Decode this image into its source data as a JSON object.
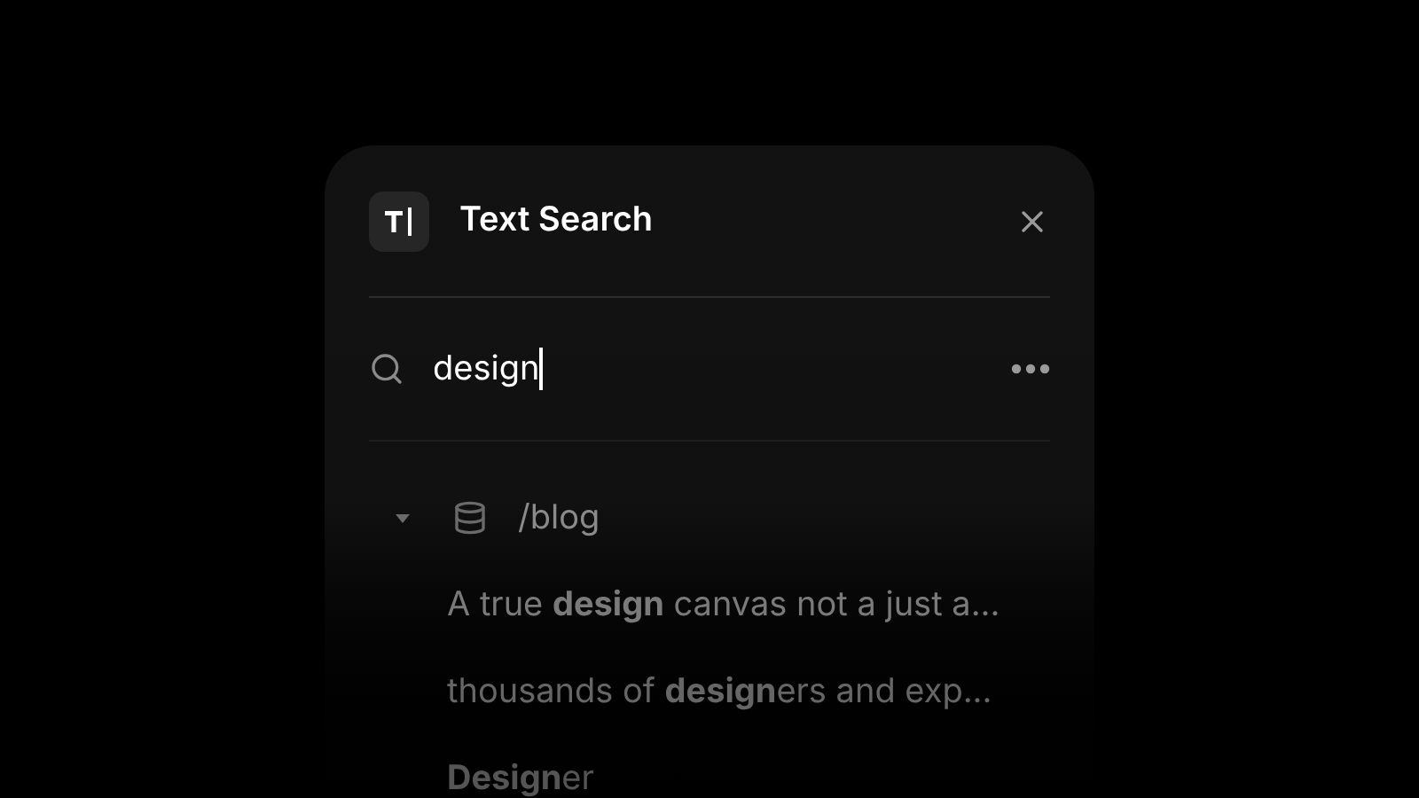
{
  "dialog": {
    "title": "Text Search"
  },
  "search": {
    "value": "design"
  },
  "results": [
    {
      "label": "/blog",
      "expanded": true,
      "children": [
        {
          "text": "A true **design** canvas not a just a..."
        },
        {
          "text": "thousands of **design**ers and exp..."
        },
        {
          "text": "**Design**er"
        }
      ]
    }
  ]
}
